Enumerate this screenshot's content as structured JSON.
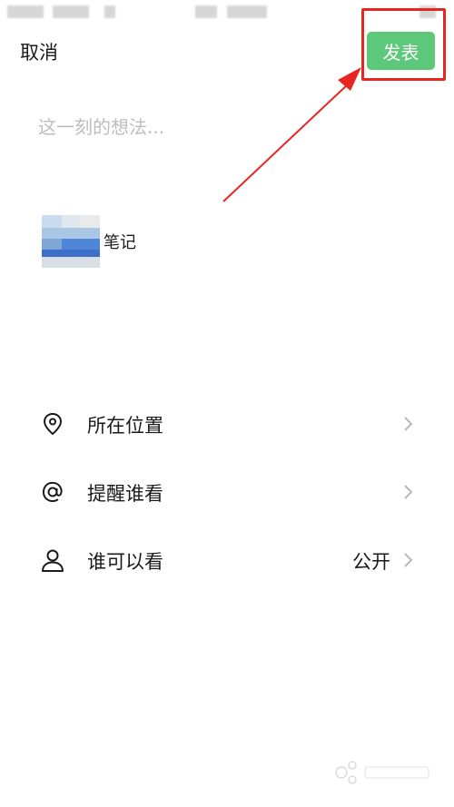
{
  "header": {
    "cancel_label": "取消",
    "publish_label": "发表"
  },
  "compose": {
    "placeholder": "这一刻的想法..."
  },
  "attachment": {
    "label": "笔记"
  },
  "options": [
    {
      "label": "所在位置",
      "icon": "location-pin-icon",
      "value": ""
    },
    {
      "label": "提醒谁看",
      "icon": "at-sign-icon",
      "value": ""
    },
    {
      "label": "谁可以看",
      "icon": "person-icon",
      "value": "公开"
    }
  ],
  "colors": {
    "publish_bg": "#5dc87a",
    "highlight": "#e8261f",
    "placeholder": "#bdbdbd"
  }
}
